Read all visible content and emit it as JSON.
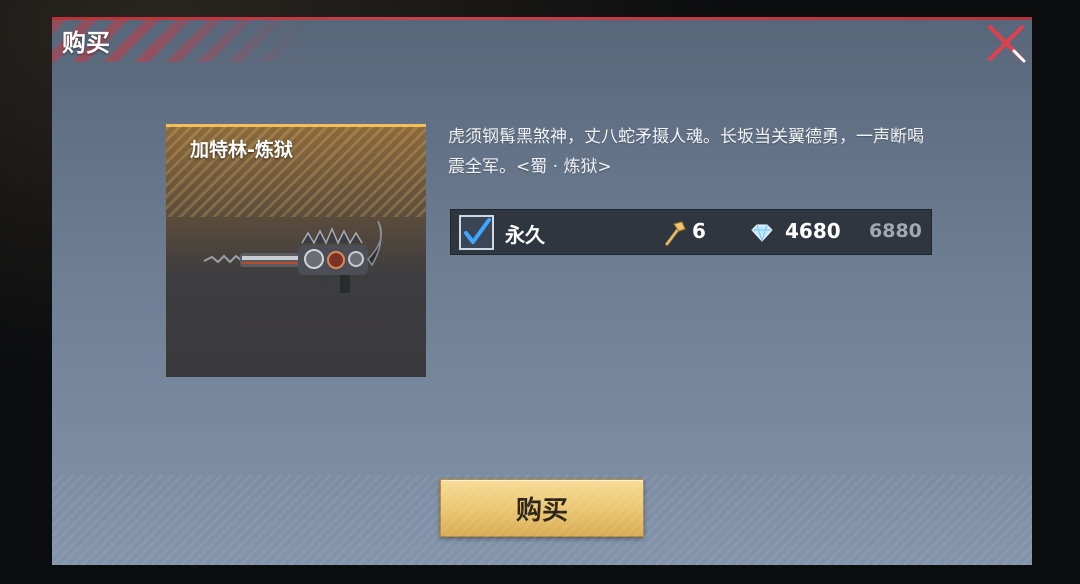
{
  "dialog": {
    "title": "购买",
    "close_icon": "close-x-icon"
  },
  "item": {
    "name": "加特林-炼狱",
    "image": "gatling-weapon-icon",
    "description": "虎须钢髯黑煞神，丈八蛇矛摄人魂。长坂当关翼德勇，一声断喝震全军。<蜀 · 炼狱>"
  },
  "purchase_option": {
    "checked": true,
    "duration": "永久",
    "key_icon": "hammer-key-icon",
    "key_count": "6",
    "currency_icon": "diamond-icon",
    "price": "4680",
    "original_price": "6880"
  },
  "buy_button": {
    "label": "购买"
  },
  "colors": {
    "accent_red": "#c7404a",
    "gold": "#eac571",
    "row_bg": "#2f3640"
  }
}
